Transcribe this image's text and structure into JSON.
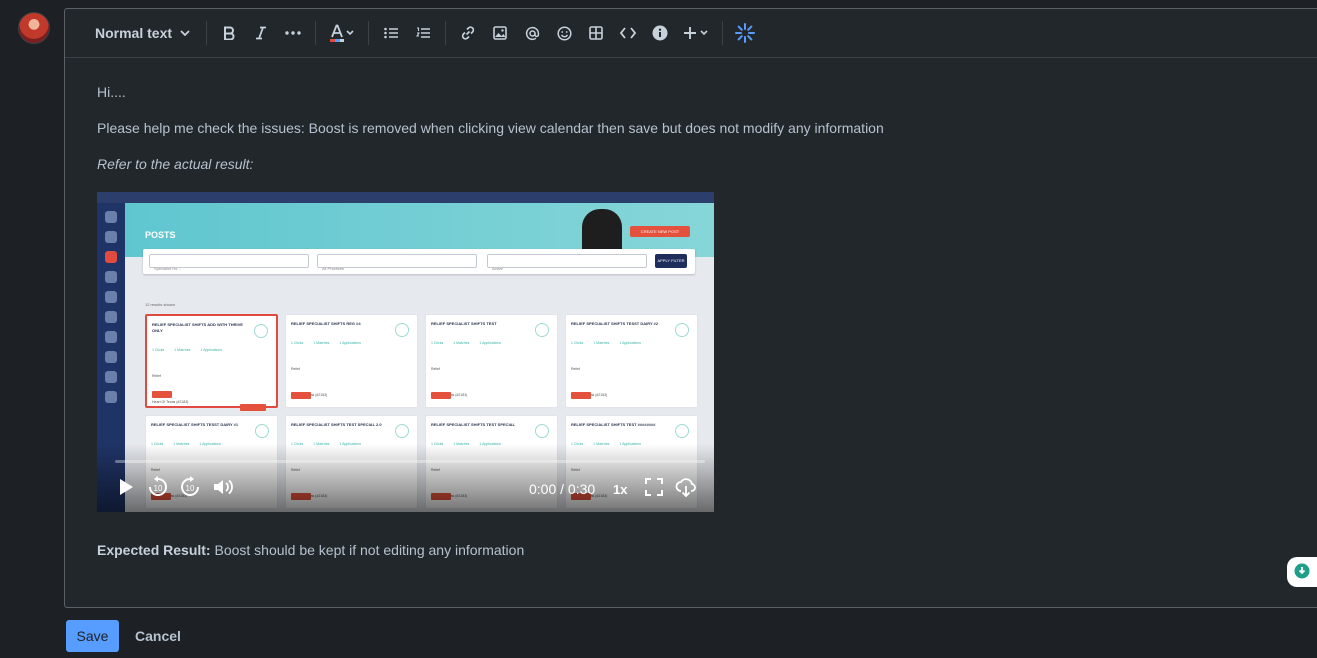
{
  "toolbar": {
    "text_style": "Normal text",
    "icons": [
      "bold-icon",
      "italic-icon",
      "more-formatting-icon",
      "text-color-icon",
      "bullet-list-icon",
      "numbered-list-icon",
      "link-icon",
      "image-icon",
      "mention-icon",
      "emoji-icon",
      "table-icon",
      "code-icon",
      "info-icon",
      "insert-more-icon",
      "ai-icon"
    ],
    "accent_color": "#579dff"
  },
  "content": {
    "greeting": "Hi....",
    "body": "Please help me check the issues: Boost is removed when clicking view calendar then save but does not modify any information",
    "refer": "Refer to the actual result:",
    "expected_label": "Expected Result:",
    "expected_text": " Boost should be kept if not editing any information"
  },
  "video": {
    "time": "0:00 / 0:30",
    "speed": "1x",
    "progress": 0,
    "frame": {
      "page_title": "POSTS",
      "create_button": "CREATE NEW POST",
      "filter_tag": "Specialist Ho...",
      "filter_practices": "All Practices",
      "filter_status": "Active",
      "apply_button": "APPLY FILTER",
      "results": "12 results shown",
      "cards": [
        {
          "title": "RELIEF SPECIALIST SHIFTS ADD WITH THRIVE ONLY",
          "boosted": true
        },
        {
          "title": "RELIEF SPECIALIST SHIFTS REG #4",
          "boosted": false
        },
        {
          "title": "RELIEF SPECIALIST SHIFTS TEST",
          "boosted": false
        },
        {
          "title": "RELIEF SPECIALIST SHIFTS TESST DAIRY #2",
          "boosted": false
        },
        {
          "title": "RELIEF SPECIALIST SHIFTS TESST DAIRY #1",
          "boosted": false
        },
        {
          "title": "RELIEF SPECIALIST SHIFTS TEST SPECIAL 2.0",
          "boosted": false
        },
        {
          "title": "RELIEF SPECIALIST SHIFTS TEST SPECIAL",
          "boosted": false
        },
        {
          "title": "RELIEF SPECIALIST SHIFTS TEST ########",
          "boosted": false
        }
      ],
      "card_stats": [
        "1 Clicks",
        "1 Matches",
        "1 Applications"
      ],
      "card_type": "Relief",
      "card_practice": "Heart Of Texas (#2183)",
      "card_location": "Round Rock, 78664",
      "boosted_label": "BOOSTED"
    }
  },
  "actions": {
    "save_label": "Save",
    "cancel_label": "Cancel"
  }
}
